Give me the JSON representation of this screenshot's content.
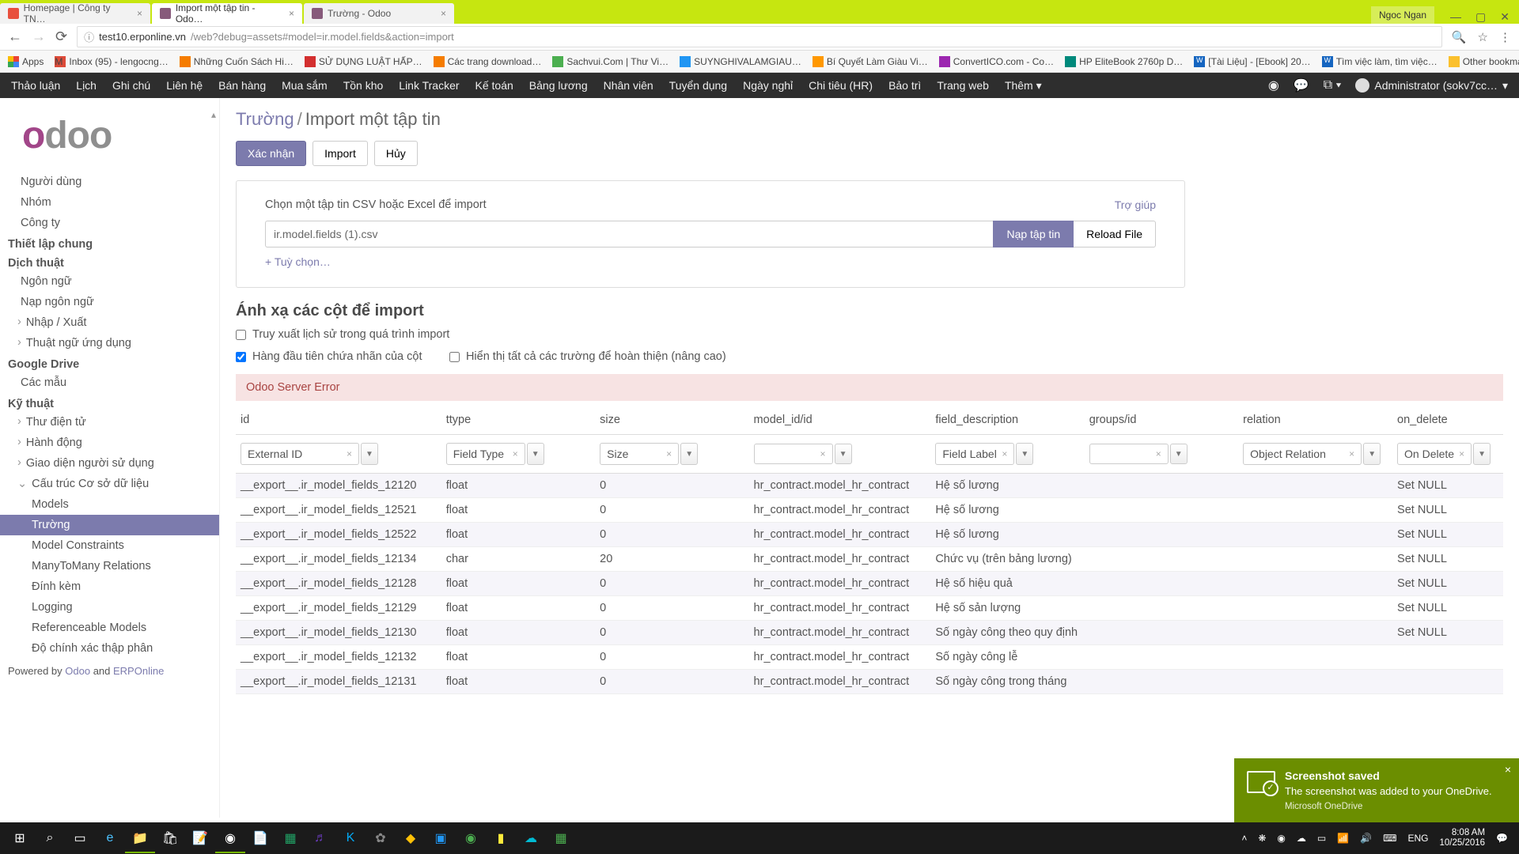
{
  "browser": {
    "tabs": [
      {
        "title": "Homepage | Công ty TN…",
        "active": false
      },
      {
        "title": "Import một tập tin - Odo…",
        "active": true
      },
      {
        "title": "Trường - Odoo",
        "active": false
      }
    ],
    "user_button": "Ngoc Ngan",
    "url_prefix": "test10.erponline.vn",
    "url_path": "/web?debug=assets#model=ir.model.fields&action=import",
    "bookmarks": [
      "Apps",
      "Inbox (95) - lengocng…",
      "Những Cuốn Sách Hi…",
      "SỬ DỤNG LUẬT HẤP…",
      "Các trang download…",
      "Sachvui.Com | Thư Vi…",
      "SUYNGHIVALAMGIAU…",
      "Bí Quyết Làm Giàu Vi…",
      "ConvertICO.com - Co…",
      "HP EliteBook 2760p D…",
      "[Tài Liệu] - [Ebook] 20…",
      "Tìm việc làm, tìm việc…"
    ],
    "other_bookmarks": "Other bookmarks"
  },
  "odoo_nav": {
    "items": [
      "Thảo luận",
      "Lịch",
      "Ghi chú",
      "Liên hệ",
      "Bán hàng",
      "Mua sắm",
      "Tồn kho",
      "Link Tracker",
      "Kế toán",
      "Bảng lương",
      "Nhân viên",
      "Tuyển dụng",
      "Ngày nghỉ",
      "Chi tiêu (HR)",
      "Bảo trì",
      "Trang web",
      "Thêm"
    ],
    "user": "Administrator (sokv7cc…"
  },
  "sidebar": {
    "users_group": [
      "Người dùng",
      "Nhóm",
      "Công ty"
    ],
    "headers": {
      "general": "Thiết lập chung",
      "translations": "Dịch thuật",
      "gdrive": "Google Drive",
      "technical": "Kỹ thuật"
    },
    "trans_items": [
      "Ngôn ngữ",
      "Nạp ngôn ngữ"
    ],
    "trans_exp": [
      "Nhập / Xuất",
      "Thuật ngữ ứng dụng"
    ],
    "gdrive_items": [
      "Các mẫu"
    ],
    "tech_exp": [
      "Thư điện tử",
      "Hành động",
      "Giao diện người sử dụng"
    ],
    "db_struct": "Cấu trúc Cơ sở dữ liệu",
    "db_items": [
      "Models",
      "Trường",
      "Model Constraints",
      "ManyToMany Relations",
      "Đính kèm",
      "Logging",
      "Referenceable Models",
      "Độ chính xác thập phân"
    ],
    "powered_prefix": "Powered by ",
    "powered_odoo": "Odoo",
    "powered_and": " and ",
    "powered_erp": "ERPOnline"
  },
  "page": {
    "breadcrumb_root": "Trường",
    "breadcrumb_current": "Import một tập tin",
    "btn_validate": "Xác nhận",
    "btn_import": "Import",
    "btn_cancel": "Hủy",
    "card_title": "Chọn một tập tin CSV hoặc Excel để import",
    "help": "Trợ giúp",
    "file_name": "ir.model.fields (1).csv",
    "btn_load": "Nạp tập tin",
    "btn_reload": "Reload File",
    "options": "+ Tuỳ chọn…",
    "map_header": "Ánh xạ các cột để import",
    "chk_history": "Truy xuất lịch sử trong quá trình import",
    "chk_first_row": "Hàng đầu tiên chứa nhãn của cột",
    "chk_show_all": "Hiển thị tất cả các trường để hoàn thiện (nâng cao)",
    "error": "Odoo Server Error"
  },
  "table": {
    "headers": [
      "id",
      "ttype",
      "size",
      "model_id/id",
      "field_description",
      "groups/id",
      "relation",
      "on_delete"
    ],
    "selectors": [
      "External ID",
      "Field Type",
      "Size",
      "",
      "Field Label",
      "",
      "Object Relation",
      "On Delete"
    ],
    "rows": [
      {
        "id": "__export__.ir_model_fields_12120",
        "ttype": "float",
        "size": "0",
        "model": "hr_contract.model_hr_contract",
        "desc": "Hệ số lương",
        "groups": "",
        "rel": "",
        "del": "Set NULL"
      },
      {
        "id": "__export__.ir_model_fields_12521",
        "ttype": "float",
        "size": "0",
        "model": "hr_contract.model_hr_contract",
        "desc": "Hệ số lương",
        "groups": "",
        "rel": "",
        "del": "Set NULL"
      },
      {
        "id": "__export__.ir_model_fields_12522",
        "ttype": "float",
        "size": "0",
        "model": "hr_contract.model_hr_contract",
        "desc": "Hệ số lương",
        "groups": "",
        "rel": "",
        "del": "Set NULL"
      },
      {
        "id": "__export__.ir_model_fields_12134",
        "ttype": "char",
        "size": "20",
        "model": "hr_contract.model_hr_contract",
        "desc": "Chức vụ (trên bảng lương)",
        "groups": "",
        "rel": "",
        "del": "Set NULL"
      },
      {
        "id": "__export__.ir_model_fields_12128",
        "ttype": "float",
        "size": "0",
        "model": "hr_contract.model_hr_contract",
        "desc": "Hệ số hiệu quả",
        "groups": "",
        "rel": "",
        "del": "Set NULL"
      },
      {
        "id": "__export__.ir_model_fields_12129",
        "ttype": "float",
        "size": "0",
        "model": "hr_contract.model_hr_contract",
        "desc": "Hệ số sản lượng",
        "groups": "",
        "rel": "",
        "del": "Set NULL"
      },
      {
        "id": "__export__.ir_model_fields_12130",
        "ttype": "float",
        "size": "0",
        "model": "hr_contract.model_hr_contract",
        "desc": "Số ngày công theo quy định",
        "groups": "",
        "rel": "",
        "del": "Set NULL"
      },
      {
        "id": "__export__.ir_model_fields_12132",
        "ttype": "float",
        "size": "0",
        "model": "hr_contract.model_hr_contract",
        "desc": "Số ngày công lễ",
        "groups": "",
        "rel": "",
        "del": ""
      },
      {
        "id": "__export__.ir_model_fields_12131",
        "ttype": "float",
        "size": "0",
        "model": "hr_contract.model_hr_contract",
        "desc": "Số ngày công trong tháng",
        "groups": "",
        "rel": "",
        "del": ""
      }
    ]
  },
  "notification": {
    "title": "Screenshot saved",
    "body": "The screenshot was added to your OneDrive.",
    "sub": "Microsoft OneDrive"
  },
  "taskbar": {
    "time": "8:08 AM",
    "date": "10/25/2016"
  }
}
